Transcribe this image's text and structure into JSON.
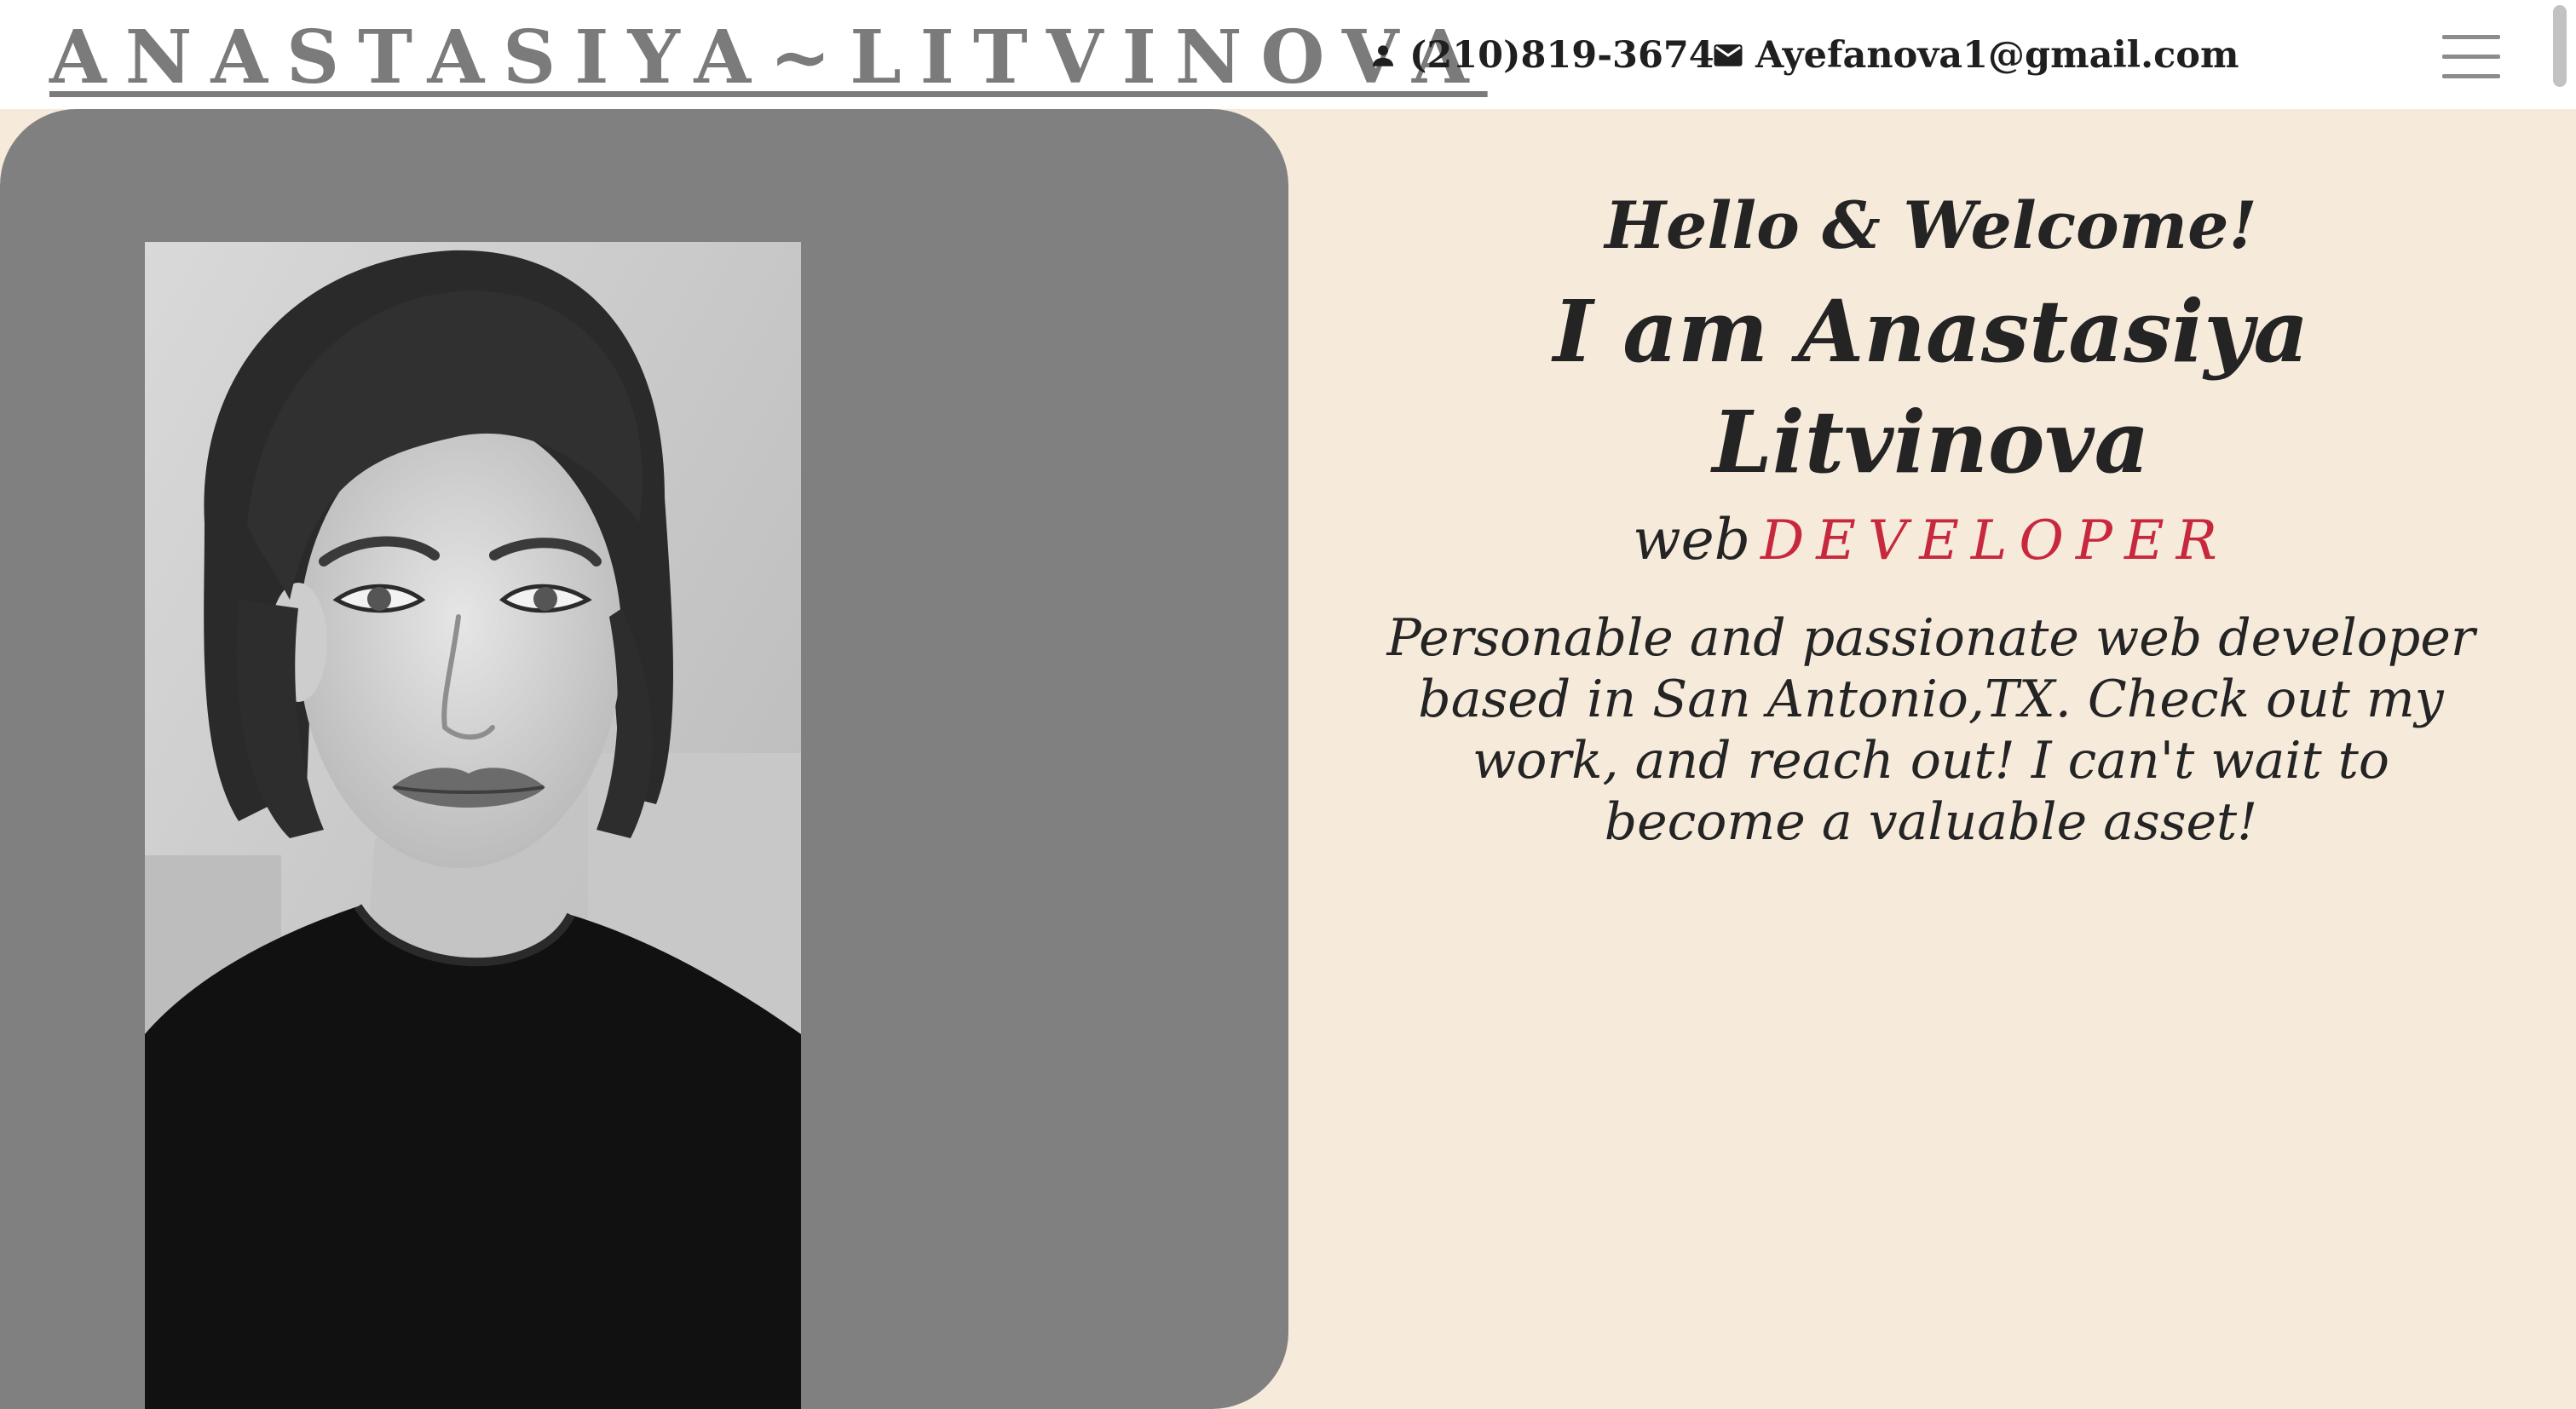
{
  "header": {
    "brand": "ANASTASIYA~LITVINOVA",
    "phone": "(210)819-3674",
    "email": "Ayefanova1@gmail.com",
    "phone_icon": "person-icon",
    "email_icon": "mail-icon",
    "menu_icon": "hamburger-menu-icon"
  },
  "hero": {
    "greeting": "Hello & Welcome!",
    "name": "I am Anastasiya Litvinova",
    "role_prefix": "web",
    "role_title": "DEVELOPER",
    "bio": "Personable and passionate web developer based in San Antonio,TX. Check out my work, and reach out! I can't wait to become a valuable asset!"
  },
  "colors": {
    "background": "#f6eadb",
    "header": "#ffffff",
    "panel": "#808080",
    "accent": "#c8283d",
    "brand": "#7b7b7b"
  }
}
